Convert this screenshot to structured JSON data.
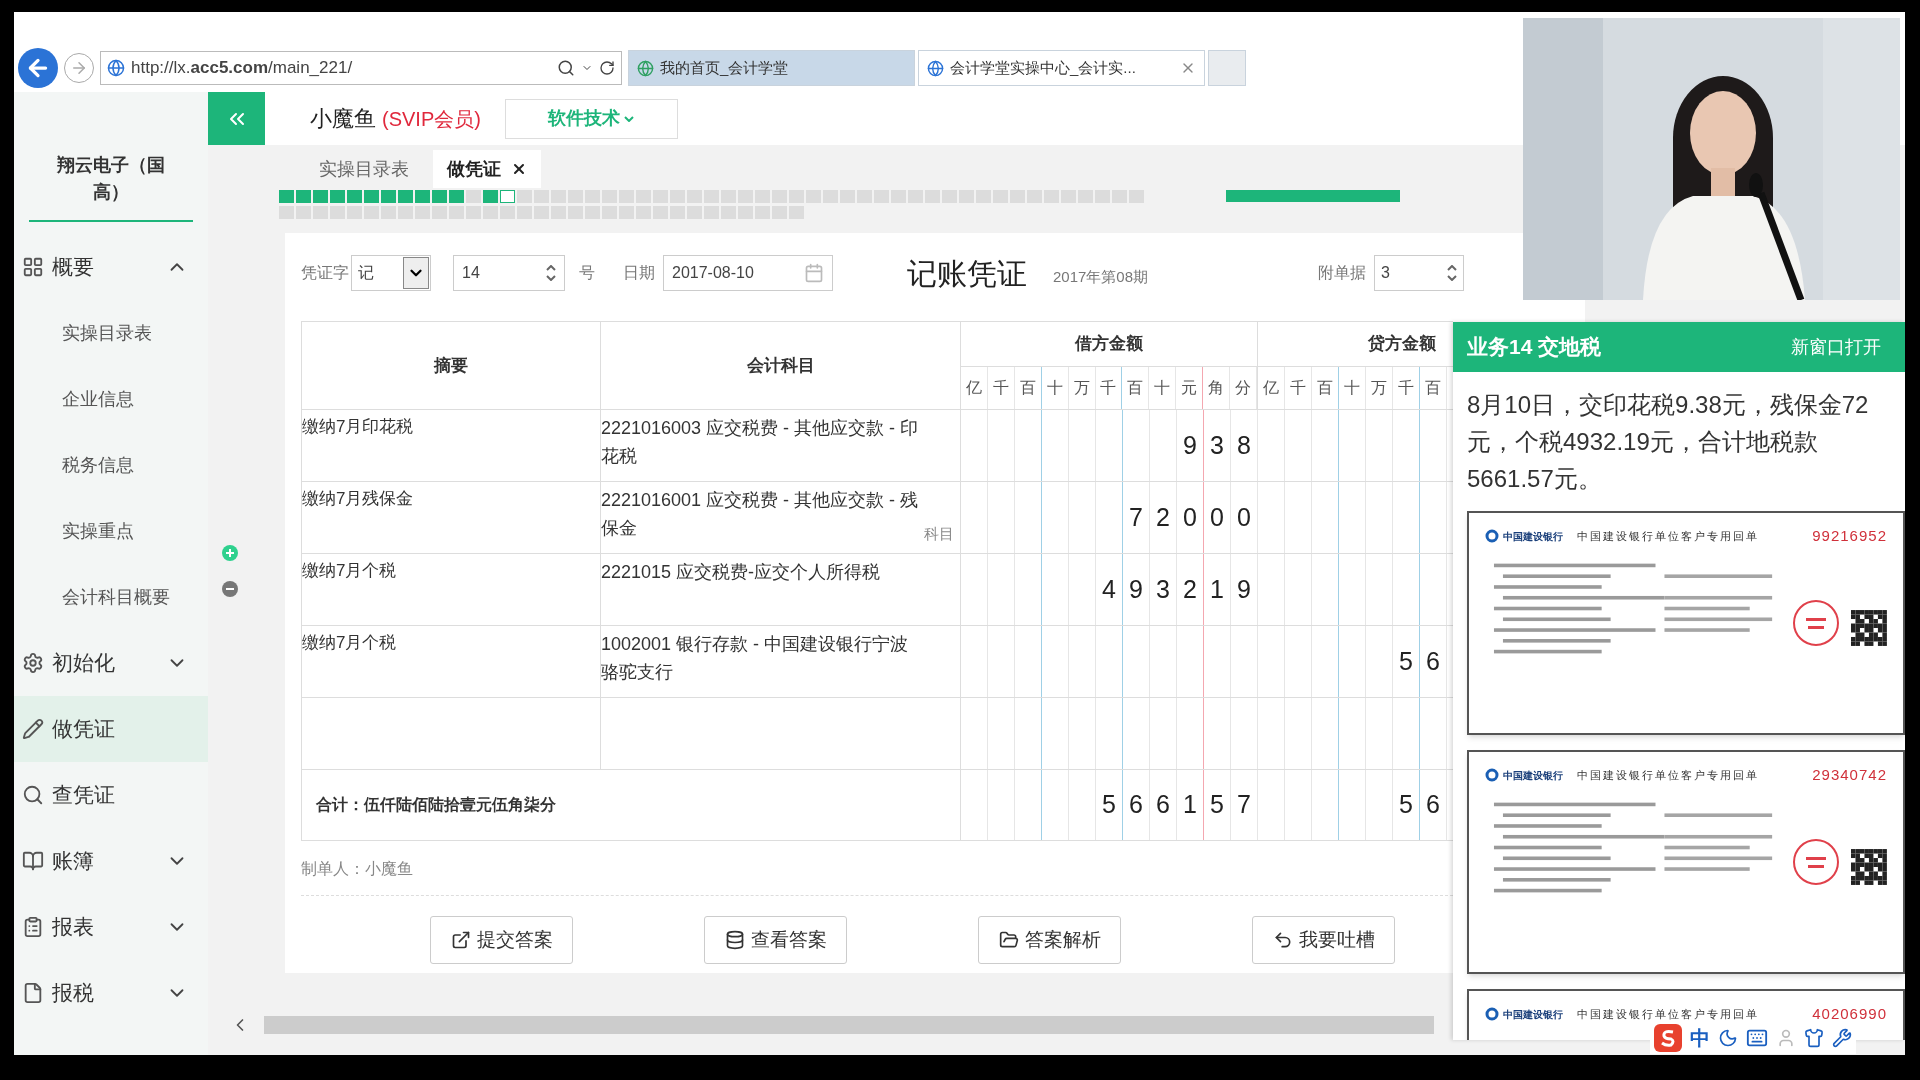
{
  "browser": {
    "address": "http://lx.**acc5.com**/main_221/",
    "tabs": [
      {
        "title": "我的首页_会计学堂",
        "selected": false
      },
      {
        "title": "会计学堂实操中心_会计实...",
        "selected": true
      }
    ]
  },
  "sidebar": {
    "company": "翔云电子（国高）",
    "items": [
      {
        "kind": "group",
        "label": "概要",
        "expanded": true,
        "children": [
          {
            "label": "实操目录表",
            "selected": false
          },
          {
            "label": "企业信息",
            "selected": false
          },
          {
            "label": "税务信息",
            "selected": false
          },
          {
            "label": "实操重点",
            "selected": false
          },
          {
            "label": "会计科目概要",
            "selected": false
          }
        ]
      },
      {
        "kind": "group",
        "label": "初始化",
        "expanded": false
      },
      {
        "kind": "link",
        "label": "做凭证",
        "selected": true
      },
      {
        "kind": "link",
        "label": "查凭证",
        "selected": false
      },
      {
        "kind": "group",
        "label": "账簿",
        "expanded": false
      },
      {
        "kind": "group",
        "label": "报表",
        "expanded": false
      },
      {
        "kind": "group",
        "label": "报税",
        "expanded": false
      }
    ]
  },
  "header": {
    "user": "小魔鱼",
    "badge": "(SVIP会员)",
    "menu": "软件技术"
  },
  "page_tabs": [
    {
      "label": "实操目录表",
      "selected": false
    },
    {
      "label": "做凭证",
      "selected": true
    }
  ],
  "questions": [
    {
      "answered": true,
      "selected": false
    },
    {
      "answered": true,
      "selected": false
    },
    {
      "answered": true,
      "selected": false
    },
    {
      "answered": true,
      "selected": false
    },
    {
      "answered": true,
      "selected": false
    },
    {
      "answered": true,
      "selected": false
    },
    {
      "answered": true,
      "selected": false
    },
    {
      "answered": true,
      "selected": false
    },
    {
      "answered": true,
      "selected": false
    },
    {
      "answered": true,
      "selected": false
    },
    {
      "answered": true,
      "selected": false
    },
    {
      "answered": false,
      "selected": false
    },
    {
      "answered": true,
      "selected": false
    },
    {
      "answered": false,
      "selected": true
    },
    {
      "answered": false,
      "selected": false
    },
    {
      "answered": false,
      "selected": false
    },
    {
      "answered": false,
      "selected": false
    },
    {
      "answered": false,
      "selected": false
    },
    {
      "answered": false,
      "selected": false
    },
    {
      "answered": false,
      "selected": false
    },
    {
      "answered": false,
      "selected": false
    },
    {
      "answered": false,
      "selected": false
    },
    {
      "answered": false,
      "selected": false
    },
    {
      "answered": false,
      "selected": false
    },
    {
      "answered": false,
      "selected": false
    },
    {
      "answered": false,
      "selected": false
    },
    {
      "answered": false,
      "selected": false
    },
    {
      "answered": false,
      "selected": false
    },
    {
      "answered": false,
      "selected": false
    },
    {
      "answered": false,
      "selected": false
    },
    {
      "answered": false,
      "selected": false
    },
    {
      "answered": false,
      "selected": false
    },
    {
      "answered": false,
      "selected": false
    },
    {
      "answered": false,
      "selected": false
    },
    {
      "answered": false,
      "selected": false
    },
    {
      "answered": false,
      "selected": false
    },
    {
      "answered": false,
      "selected": false
    },
    {
      "answered": false,
      "selected": false
    },
    {
      "answered": false,
      "selected": false
    },
    {
      "answered": false,
      "selected": false
    },
    {
      "answered": false,
      "selected": false
    },
    {
      "answered": false,
      "selected": false
    },
    {
      "answered": false,
      "selected": false
    },
    {
      "answered": false,
      "selected": false
    },
    {
      "answered": false,
      "selected": false
    },
    {
      "answered": false,
      "selected": false
    },
    {
      "answered": false,
      "selected": false
    },
    {
      "answered": false,
      "selected": false
    },
    {
      "answered": false,
      "selected": false
    },
    {
      "answered": false,
      "selected": false
    },
    {
      "answered": false,
      "selected": false
    },
    {
      "answered": false,
      "selected": false
    },
    {
      "answered": false,
      "selected": false
    },
    {
      "answered": false,
      "selected": false
    },
    {
      "answered": false,
      "selected": false
    },
    {
      "answered": false,
      "selected": false
    },
    {
      "answered": false,
      "selected": false
    },
    {
      "answered": false,
      "selected": false
    },
    {
      "answered": false,
      "selected": false
    },
    {
      "answered": false,
      "selected": false
    },
    {
      "answered": false,
      "selected": false
    },
    {
      "answered": false,
      "selected": false
    },
    {
      "answered": false,
      "selected": false
    },
    {
      "answered": false,
      "selected": false
    },
    {
      "answered": false,
      "selected": false
    },
    {
      "answered": false,
      "selected": false
    },
    {
      "answered": false,
      "selected": false
    },
    {
      "answered": false,
      "selected": false
    },
    {
      "answered": false,
      "selected": false
    },
    {
      "answered": false,
      "selected": false
    },
    {
      "answered": false,
      "selected": false
    },
    {
      "answered": false,
      "selected": false
    },
    {
      "answered": false,
      "selected": false
    },
    {
      "answered": false,
      "selected": false
    },
    {
      "answered": false,
      "selected": false
    },
    {
      "answered": false,
      "selected": false
    },
    {
      "answered": false,
      "selected": false
    },
    {
      "answered": false,
      "selected": false
    },
    {
      "answered": false,
      "selected": false
    },
    {
      "answered": false,
      "selected": false
    },
    {
      "answered": false,
      "selected": false
    },
    {
      "answered": false,
      "selected": false
    }
  ],
  "voucher": {
    "word_label": "凭证字",
    "word": "记",
    "number": "14",
    "number_suffix": "号",
    "date_label": "日期",
    "date": "2017-08-10",
    "title": "记账凭证",
    "period": "2017年第08期",
    "attachments_label": "附单据",
    "attachments": "3"
  },
  "table": {
    "summary_header": "摘要",
    "account_header": "会计科目",
    "debit_header": "借方金额",
    "credit_header": "贷方金额",
    "debit_columns": [
      "亿",
      "千",
      "百",
      "十",
      "万",
      "千",
      "百",
      "十",
      "元",
      "角",
      "分"
    ],
    "credit_columns": [
      "亿",
      "千",
      "百",
      "十",
      "万",
      "千",
      "百"
    ],
    "rows": [
      {
        "kind": "entry",
        "summary": "缴纳7月印花税",
        "account": "2221016003 应交税费 - 其他应交款 - 印花税",
        "debit": [
          "9",
          "3",
          "8"
        ]
      },
      {
        "kind": "entry",
        "summary": "缴纳7月残保金",
        "account": "2221016001 应交税费 - 其他应交款 - 残保金",
        "hint": "科目",
        "debit": [
          "7",
          "2",
          "0",
          "0",
          "0"
        ]
      },
      {
        "kind": "entry",
        "summary": "缴纳7月个税",
        "account": "2221015 应交税费-应交个人所得税",
        "debit": [
          "4",
          "9",
          "3",
          "2",
          "1",
          "9"
        ]
      },
      {
        "kind": "entry",
        "summary": "缴纳7月个税",
        "account": "1002001 银行存款 - 中国建设银行宁波骆驼支行",
        "credit": [
          "5",
          "6"
        ]
      },
      {
        "kind": "blank"
      }
    ],
    "total": {
      "label": "合计：伍仟陆佰陆拾壹元伍角柒分",
      "debit": [
        "5",
        "6",
        "6",
        "1",
        "5",
        "7"
      ],
      "credit": [
        "5",
        "6"
      ]
    }
  },
  "maker": "制单人：小魔鱼",
  "actions": [
    "提交答案",
    "查看答案",
    "答案解析",
    "我要吐槽"
  ],
  "task": {
    "title": "业务14 交地税",
    "open_link": "新窗口打开",
    "lines": [
      "8月10日，交印花税9.38元，残保金72",
      "元，个税4932.19元，合计地税款",
      "5661.57元。"
    ],
    "receipts": [
      {
        "bank": "中国建设银行",
        "title": "中国建设银行单位客户专用回单",
        "number": "99216952"
      },
      {
        "bank": "中国建设银行",
        "title": "中国建设银行单位客户专用回单",
        "number": "29340742"
      },
      {
        "bank": "中国建设银行",
        "title": "中国建设银行单位客户专用回单",
        "number": "40206990"
      }
    ]
  },
  "ime": {
    "mode": "中"
  }
}
